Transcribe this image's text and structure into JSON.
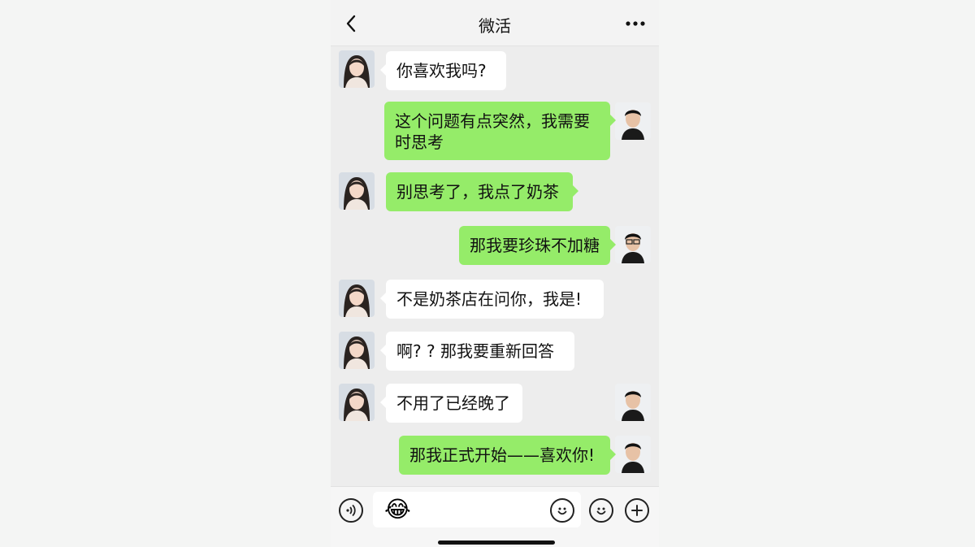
{
  "header": {
    "title": "微活",
    "back_icon": "chevron-left-icon",
    "more_icon": "more-dots-icon"
  },
  "colors": {
    "outgoing_bubble": "#95ec69",
    "incoming_bubble": "#ffffff",
    "chat_background": "#ededed"
  },
  "messages": [
    {
      "from": "her",
      "text": "你喜欢我吗?"
    },
    {
      "from": "me",
      "text": "这个问题有点突然，我需要时思考"
    },
    {
      "from": "her",
      "text": "别思考了，我点了奶茶"
    },
    {
      "from": "me",
      "text": "那我要珍珠不加糖"
    },
    {
      "from": "her",
      "text": "不是奶茶店在问你，我是!"
    },
    {
      "from": "her",
      "text": "啊? ? 那我要重新回答"
    },
    {
      "from": "her",
      "text": "不用了已经晚了"
    },
    {
      "from": "me",
      "text": "那我正式开始——喜欢你!"
    }
  ],
  "input": {
    "value": "😂",
    "voice_icon": "voice-icon",
    "emoji_icon": "smiley-icon",
    "sticker_icon": "smiley-icon",
    "add_icon": "plus-icon"
  }
}
